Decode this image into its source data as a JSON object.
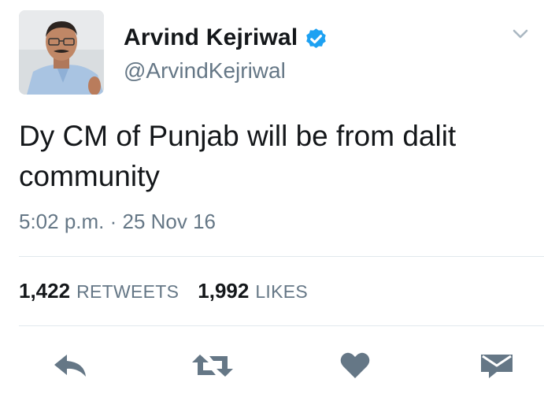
{
  "tweet": {
    "author": {
      "display_name": "Arvind Kejriwal",
      "handle": "@ArvindKejriwal",
      "verified": true,
      "avatar_icon": "avatar-photo"
    },
    "text": "Dy CM of Punjab will be from dalit community",
    "timestamp": "5:02 p.m. · 25 Nov 16",
    "stats": {
      "retweets_count": "1,422",
      "retweets_label": "RETWEETS",
      "likes_count": "1,992",
      "likes_label": "LIKES"
    },
    "actions": {
      "reply_icon": "reply-icon",
      "retweet_icon": "retweet-icon",
      "like_icon": "heart-icon",
      "dm_icon": "envelope-icon"
    },
    "menu_icon": "chevron-down-icon"
  },
  "colors": {
    "text_primary": "#14171a",
    "text_secondary": "#657786",
    "verified_blue": "#1da1f2",
    "action_icon": "#657786",
    "divider": "#e1e8ed"
  }
}
